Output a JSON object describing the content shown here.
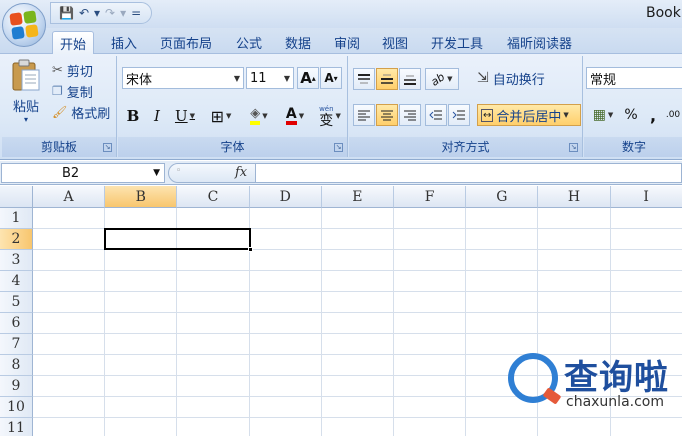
{
  "window": {
    "title": "Book"
  },
  "qat": {
    "save_icon": "💾",
    "undo_icon": "↶",
    "redo_icon": "↷",
    "dropdown_icon": "▾",
    "customize_icon": "="
  },
  "tabs": [
    {
      "label": "开始"
    },
    {
      "label": "插入"
    },
    {
      "label": "页面布局"
    },
    {
      "label": "公式"
    },
    {
      "label": "数据"
    },
    {
      "label": "审阅"
    },
    {
      "label": "视图"
    },
    {
      "label": "开发工具"
    },
    {
      "label": "福昕阅读器"
    }
  ],
  "clipboard": {
    "group_label": "剪贴板",
    "paste_label": "粘贴",
    "paste_arrow": "▾",
    "cut_label": "剪切",
    "copy_label": "复制",
    "format_painter_label": "格式刷",
    "launcher": "↘"
  },
  "font": {
    "group_label": "字体",
    "font_name": "宋体",
    "font_size": "11",
    "grow_font": "A",
    "shrink_font": "A",
    "bold": "B",
    "italic": "I",
    "underline": "U",
    "border_icon": "⊞",
    "fill_icon": "◈",
    "font_color_icon": "A",
    "phonetic_label": "wén",
    "phonetic_char": "变",
    "launcher": "↘"
  },
  "alignment": {
    "group_label": "对齐方式",
    "wrap_text_label": "自动换行",
    "merge_center_label": "合并后居中",
    "orientation_icon": "ab",
    "launcher": "↘"
  },
  "number": {
    "group_label": "数字",
    "format_value": "常规",
    "percent": "%",
    "comma": ","
  },
  "formula_bar": {
    "name_box": "B2",
    "name_arrow": "▼",
    "fx_label": "fx",
    "value": ""
  },
  "sheet": {
    "columns": [
      "A",
      "B",
      "C",
      "D",
      "E",
      "F",
      "G",
      "H",
      "I"
    ],
    "rows": [
      "1",
      "2",
      "3",
      "4",
      "5",
      "6",
      "7",
      "8",
      "9",
      "10",
      "11"
    ],
    "selected_cell": "B2"
  },
  "watermark": {
    "text": "查询啦",
    "sub": "chaxunla.com"
  },
  "colors": {
    "accent": "#15428b",
    "selection": "#f8c66e",
    "ribbon": "#dde9f7"
  }
}
